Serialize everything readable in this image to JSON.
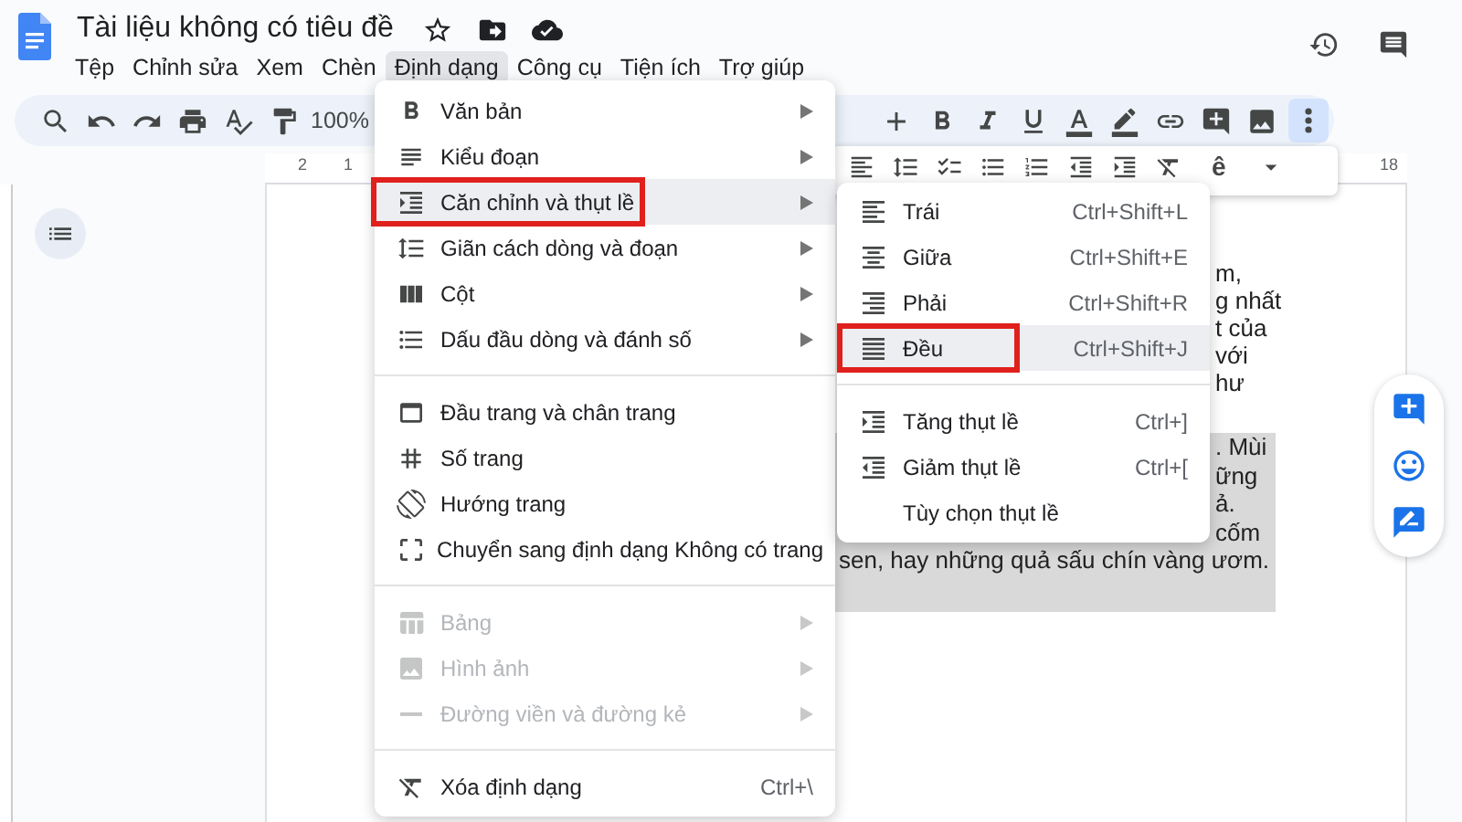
{
  "title": "Tài liệu không có tiêu đề",
  "menu_bar": [
    {
      "label": "Tệp",
      "selected": false
    },
    {
      "label": "Chỉnh sửa",
      "selected": false
    },
    {
      "label": "Xem",
      "selected": false
    },
    {
      "label": "Chèn",
      "selected": false
    },
    {
      "label": "Định dạng",
      "selected": true
    },
    {
      "label": "Công cụ",
      "selected": false
    },
    {
      "label": "Tiện ích",
      "selected": false
    },
    {
      "label": "Trợ giúp",
      "selected": false
    }
  ],
  "toolbar": {
    "zoom": "100%",
    "input_tool": "ê",
    "more_options": {
      "selected": true
    }
  },
  "ruler": {
    "marks": [
      "2",
      "1",
      "18"
    ]
  },
  "format_menu": {
    "sections": [
      [
        {
          "label": "Văn bản",
          "submenu": true,
          "selected": false,
          "disabled": false,
          "annotated": false
        },
        {
          "label": "Kiểu đoạn",
          "submenu": true,
          "selected": false,
          "disabled": false,
          "annotated": false
        },
        {
          "label": "Căn chỉnh và thụt lề",
          "submenu": true,
          "selected": true,
          "disabled": false,
          "annotated": true
        },
        {
          "label": "Giãn cách dòng và đoạn",
          "submenu": true,
          "selected": false,
          "disabled": false,
          "annotated": false
        },
        {
          "label": "Cột",
          "submenu": true,
          "selected": false,
          "disabled": false,
          "annotated": false
        },
        {
          "label": "Dấu đầu dòng và đánh số",
          "submenu": true,
          "selected": false,
          "disabled": false,
          "annotated": false
        }
      ],
      [
        {
          "label": "Đầu trang và chân trang",
          "submenu": false,
          "selected": false,
          "disabled": false,
          "annotated": false
        },
        {
          "label": "Số trang",
          "submenu": false,
          "selected": false,
          "disabled": false,
          "annotated": false
        },
        {
          "label": "Hướng trang",
          "submenu": false,
          "selected": false,
          "disabled": false,
          "annotated": false
        },
        {
          "label": "Chuyển sang định dạng Không có trang",
          "submenu": false,
          "selected": false,
          "disabled": false,
          "annotated": false
        }
      ],
      [
        {
          "label": "Bảng",
          "submenu": true,
          "selected": false,
          "disabled": true,
          "annotated": false
        },
        {
          "label": "Hình ảnh",
          "submenu": true,
          "selected": false,
          "disabled": true,
          "annotated": false
        },
        {
          "label": "Đường viền và đường kẻ",
          "submenu": true,
          "selected": false,
          "disabled": true,
          "annotated": false
        }
      ],
      [
        {
          "label": "Xóa định dạng",
          "shortcut": "Ctrl+\\",
          "submenu": false,
          "selected": false,
          "disabled": false,
          "annotated": false
        }
      ]
    ]
  },
  "alignment_submenu": {
    "sections": [
      [
        {
          "label": "Trái",
          "shortcut": "Ctrl+Shift+L",
          "selected": false,
          "annotated": false
        },
        {
          "label": "Giữa",
          "shortcut": "Ctrl+Shift+E",
          "selected": false,
          "annotated": false
        },
        {
          "label": "Phải",
          "shortcut": "Ctrl+Shift+R",
          "selected": false,
          "annotated": false
        },
        {
          "label": "Đều",
          "shortcut": "Ctrl+Shift+J",
          "selected": true,
          "annotated": true
        }
      ],
      [
        {
          "label": "Tăng thụt lề",
          "shortcut": "Ctrl+]",
          "selected": false,
          "annotated": false
        },
        {
          "label": "Giảm thụt lề",
          "shortcut": "Ctrl+[",
          "selected": false,
          "annotated": false
        },
        {
          "label": "Tùy chọn thụt lề",
          "selected": false,
          "annotated": false
        }
      ]
    ]
  },
  "document": {
    "line_ends": [
      "m,",
      "g nhất",
      "t của",
      "với",
      "hư"
    ],
    "highlighted_line_ends": [
      ". Mùi",
      "ững",
      "ả.",
      "cốm"
    ],
    "last_line": "sen, hay những quả sấu chín vàng ươm."
  }
}
